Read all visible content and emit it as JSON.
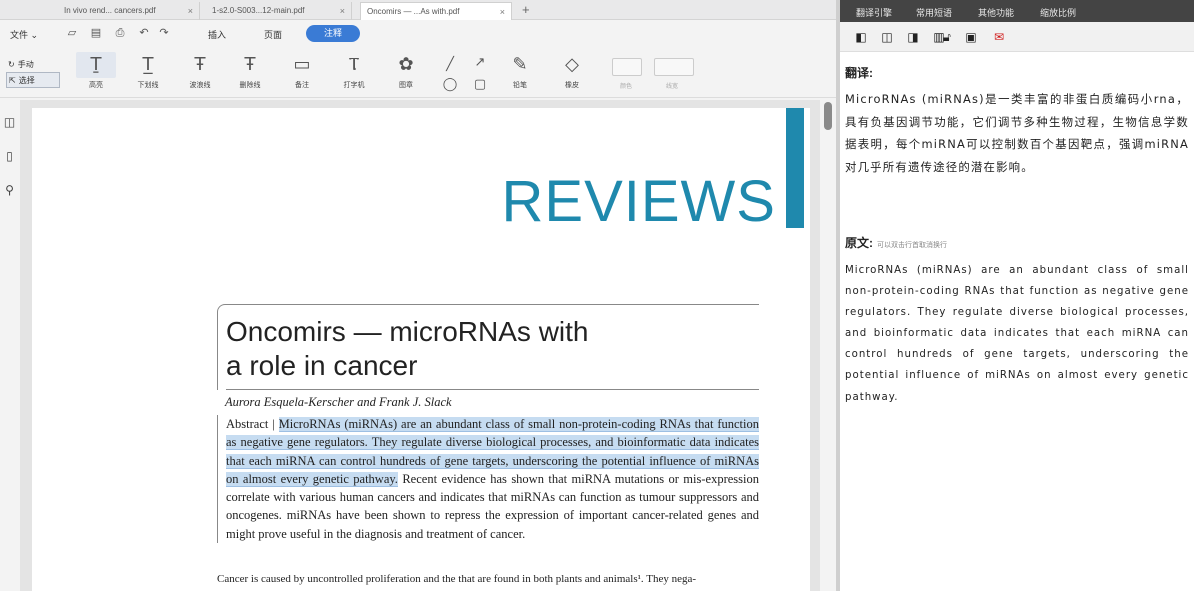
{
  "tabs": [
    {
      "title": "In vivo rend... cancers.pdf",
      "close": "×"
    },
    {
      "title": "1-s2.0-S003...12-main.pdf",
      "close": "×"
    },
    {
      "title": "Oncomirs — ...As with.pdf",
      "close": "×"
    }
  ],
  "tab_add": "+",
  "menu": {
    "file": "文件",
    "file_caret": "⌄",
    "insert": "插入",
    "page": "页面",
    "mode_pill": "注释"
  },
  "side_tools": [
    {
      "icon": "↻",
      "label": "手动"
    },
    {
      "icon": "⇱",
      "label": "选择"
    }
  ],
  "tools": [
    {
      "glyph": "Ṯ",
      "label": "高亮"
    },
    {
      "glyph": "T̲",
      "label": "下划线"
    },
    {
      "glyph": "Ŧ",
      "label": "波浪线"
    },
    {
      "glyph": "Ŧ",
      "label": "删除线"
    },
    {
      "glyph": "▭",
      "label": "备注"
    },
    {
      "glyph": "Ⲧ",
      "label": "打字机"
    },
    {
      "glyph": "✿",
      "label": "图章"
    },
    {
      "glyph": "✎",
      "label": "铅笔"
    },
    {
      "glyph": "◇",
      "label": "橡皮"
    }
  ],
  "shape_tools": {
    "line": "╱",
    "arrow": "↗",
    "ellipse": "◯",
    "rect": "▢"
  },
  "control_labels": {
    "color": "颜色",
    "width": "线宽"
  },
  "page": {
    "reviews": "REVIEWS",
    "title_line1": "Oncomirs — microRNAs with",
    "title_line2": "a role in cancer",
    "authors": "Aurora Esquela-Kerscher and Frank J. Slack",
    "abstract_lead": "Abstract | ",
    "abstract_highlight": "MicroRNAs (miRNAs) are an abundant class of small non-protein-coding RNAs that function as negative gene regulators. They regulate diverse biological processes, and bioinformatic data indicates that each miRNA can control hundreds of gene targets, underscoring the potential influence of miRNAs on almost every genetic pathway.",
    "abstract_rest": " Recent evidence has shown that miRNA mutations or mis-expression correlate with various human cancers and indicates that miRNAs can function as tumour suppressors and oncogenes. miRNAs have been shown to repress the expression of important cancer-related genes and might prove useful in the diagnosis and treatment of cancer.",
    "body_start": "Cancer is caused by uncontrolled proliferation and the     that are found in both plants and animals¹. They nega-"
  },
  "panel": {
    "menu": [
      "翻译引擎",
      "常用短语",
      "其他功能",
      "缩放比例"
    ],
    "translation_heading": "翻译:",
    "translation": "MicroRNAs (miRNAs)是一类丰富的非蛋白质编码小rna，具有负基因调节功能，它们调节多种生物过程，生物信息学数据表明，每个miRNA可以控制数百个基因靶点，强调miRNA对几乎所有遗传途径的潜在影响。",
    "original_heading": "原文:",
    "original_sub": "可以双击行首取消换行",
    "original": "MicroRNAs (miRNAs) are an abundant class of small non-protein-coding RNAs that function as negative gene regulators. They regulate diverse biological processes, and bioinformatic data indicates that each miRNA can control hundreds of gene targets, underscoring the potential influence of miRNAs on almost every genetic pathway."
  },
  "colors": {
    "accent_blue": "#1f89ad",
    "highlight": "#c6dcf1",
    "mode_pill": "#3a7bd5",
    "panel_menu_bg": "#444444",
    "mail_icon": "#d01a1a"
  }
}
